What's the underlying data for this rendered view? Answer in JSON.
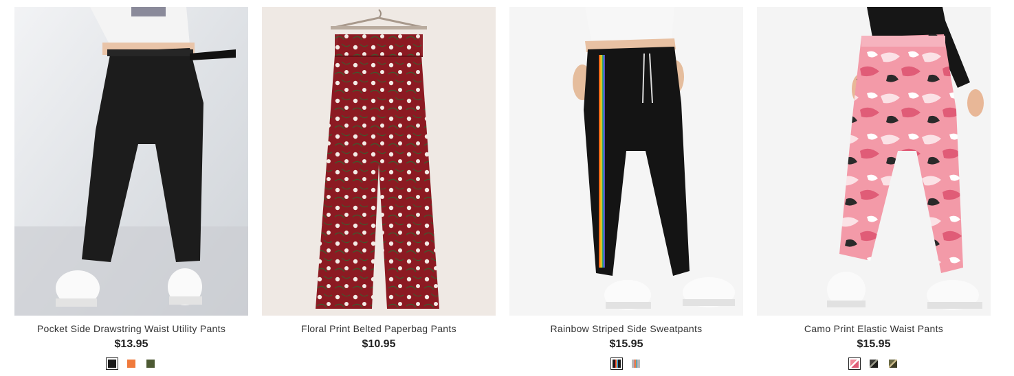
{
  "products": [
    {
      "title": "Pocket Side Drawstring Waist Utility Pants",
      "price": "$13.95",
      "image": "black-utility-pants-photo",
      "swatches": [
        {
          "color": "#1b1b1b",
          "selected": true
        },
        {
          "color": "#f07a3c",
          "selected": false
        },
        {
          "color": "#4d5a33",
          "selected": false
        }
      ]
    },
    {
      "title": "Floral Print Belted Paperbag Pants",
      "price": "$10.95",
      "image": "red-floral-pants-photo",
      "swatches": []
    },
    {
      "title": "Rainbow Striped Side Sweatpants",
      "price": "$15.95",
      "image": "black-rainbow-sweatpants-photo",
      "swatches": [
        {
          "color": "#1a1a1a",
          "accent": "rainbow",
          "selected": true
        },
        {
          "color": "#b8b8b8",
          "accent": "rainbow",
          "selected": false
        }
      ]
    },
    {
      "title": "Camo Print Elastic Waist Pants",
      "price": "$15.95",
      "image": "pink-camo-pants-photo",
      "swatches": [
        {
          "color": "#f08a9a",
          "accent": "camo-pink",
          "selected": true
        },
        {
          "color": "#3a3a36",
          "accent": "camo-dark",
          "selected": false
        },
        {
          "color": "#6b6a44",
          "accent": "camo-green",
          "selected": false
        }
      ]
    }
  ]
}
